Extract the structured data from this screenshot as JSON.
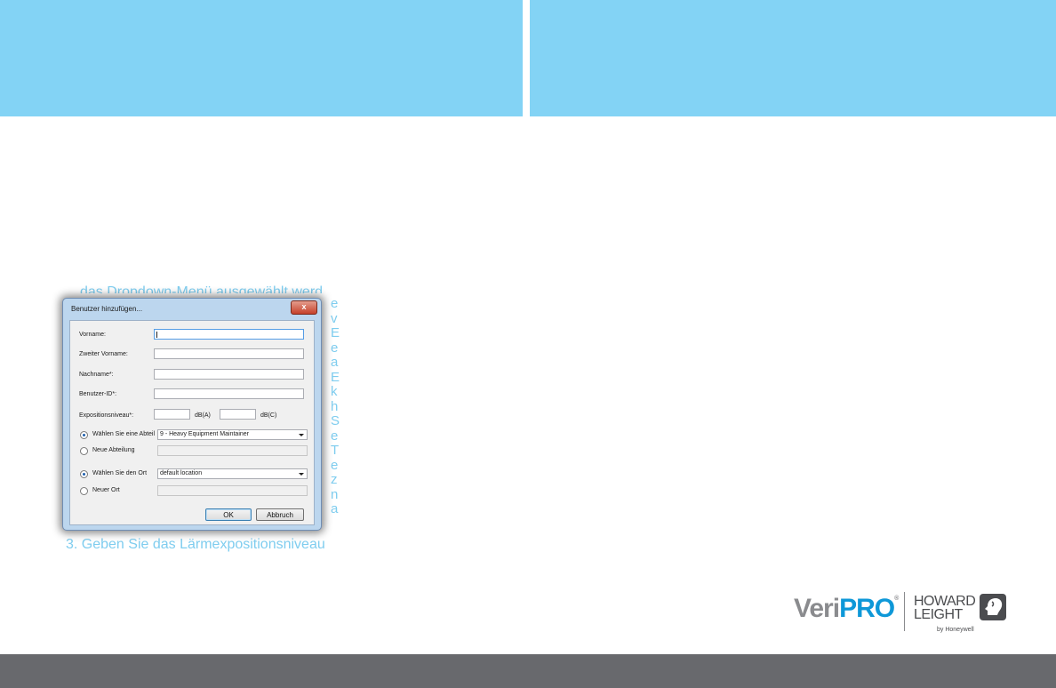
{
  "background_text": {
    "top_line": "das Dropdown-Menü ausgewählt werd",
    "bottom_line": "3. Geben Sie das Lärmexpositionsniveau",
    "right_letters": [
      "e",
      "v",
      "E",
      "e",
      "a",
      "E",
      "k",
      "h",
      "S",
      "e",
      "T",
      "e",
      "z",
      "n",
      "a"
    ]
  },
  "dialog": {
    "title": "Benutzer hinzufügen...",
    "close_label": "x",
    "fields": {
      "first_name_label": "Vorname:",
      "middle_name_label": "Zweiter Vorname:",
      "last_name_label": "Nachname*:",
      "user_id_label": "Benutzer-ID*:",
      "exposure_label": "Expositionsniveau*:",
      "dba_unit": "dB(A)",
      "dbc_unit": "dB(C)"
    },
    "department": {
      "select_option_label": "Wählen Sie eine Abteil",
      "selected_value": "9 - Heavy Equipment Maintainer",
      "new_option_label": "Neue Abteilung"
    },
    "location": {
      "select_option_label": "Wählen Sie den Ort",
      "selected_value": "default location",
      "new_option_label": "Neuer Ort"
    },
    "buttons": {
      "ok": "OK",
      "cancel": "Abbruch"
    }
  },
  "logo": {
    "veri": "Veri",
    "pro": "PRO",
    "reg": "®",
    "howard": "HOWARD",
    "leight": "LEIGHT",
    "byline": "by Honeywell"
  },
  "colors": {
    "banner": "#83d3f5",
    "footer_bar": "#68696d",
    "pro_blue": "#0e98d8"
  }
}
